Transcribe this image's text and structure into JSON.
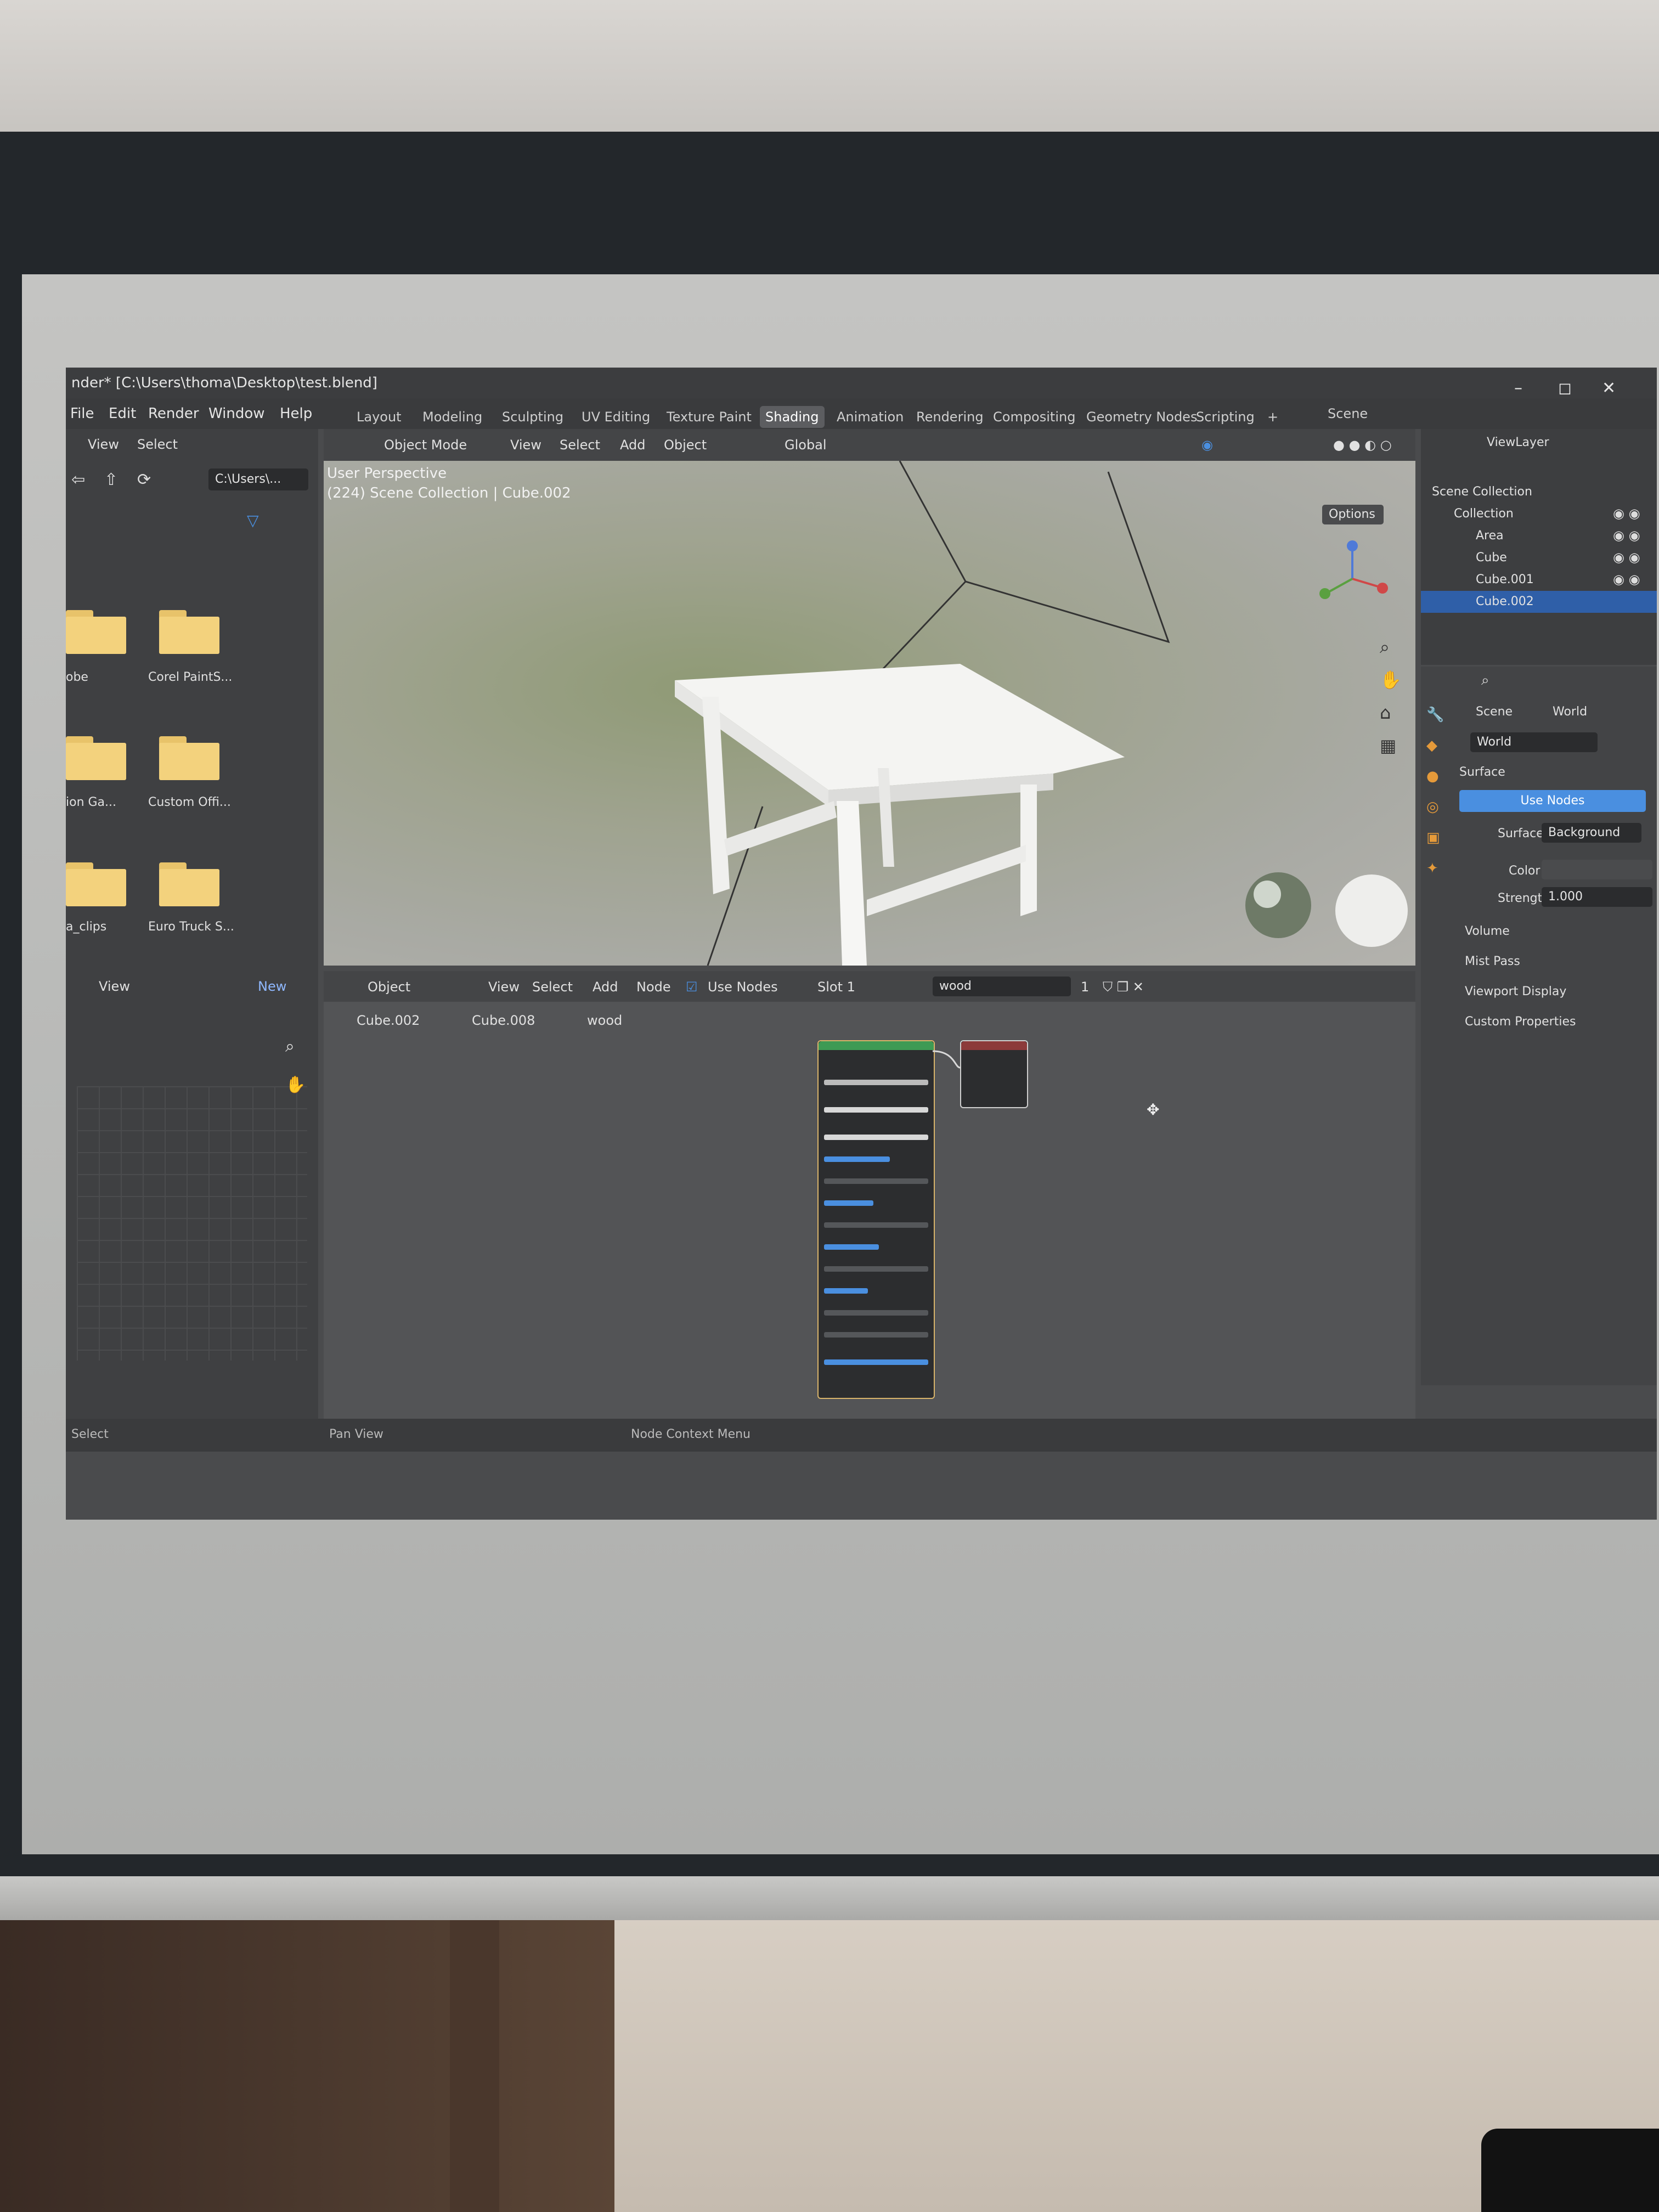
{
  "window": {
    "title": "nder* [C:\\Users\\thoma\\Desktop\\test.blend]",
    "menu": [
      "File",
      "Edit",
      "Render",
      "Window",
      "Help"
    ],
    "controls": [
      "–",
      "◻",
      "✕"
    ]
  },
  "workspace_tabs": [
    "Layout",
    "Modeling",
    "Sculpting",
    "UV Editing",
    "Texture Paint",
    "Shading",
    "Animation",
    "Rendering",
    "Compositing",
    "Geometry Nodes",
    "Scripting",
    "+"
  ],
  "active_workspace": "Shading",
  "file_browser": {
    "header": [
      "View",
      "Select"
    ],
    "path": "C:\\Users\\...",
    "folders": [
      "obe",
      "Corel PaintS...",
      "ion Ga...",
      "Custom Offi...",
      "a_clips",
      "Euro Truck S..."
    ]
  },
  "viewport": {
    "mode": "Object Mode",
    "menu": [
      "View",
      "Select",
      "Add",
      "Object"
    ],
    "orientation": "Global",
    "perspective_label": "User Perspective",
    "collection_label": "(224) Scene Collection | Cube.002",
    "options_label": "Options"
  },
  "scene_selector": "Scene",
  "view_layer": "ViewLayer",
  "outliner": {
    "rows": [
      "Scene Collection",
      "Collection",
      "Area",
      "Cube",
      "Cube.001",
      "Cube.002"
    ]
  },
  "properties": {
    "breadcrumb": [
      "Scene",
      "World"
    ],
    "world_name": "World",
    "surface_panel": "Surface",
    "use_nodes_button": "Use Nodes",
    "surface_label": "Surface",
    "surface_value": "Background",
    "color_label": "Color",
    "strength_label": "Strength",
    "strength_value": "1.000",
    "collapsed_panels": [
      "Volume",
      "Mist Pass",
      "Viewport Display",
      "Custom Properties"
    ]
  },
  "node_editor": {
    "left_header": [
      "View",
      "New"
    ],
    "type": "Object",
    "menu": [
      "View",
      "Select",
      "Add",
      "Node"
    ],
    "use_nodes_label": "Use Nodes",
    "slot": "Slot 1",
    "material": "wood",
    "user_count": "1",
    "breadcrumb": [
      "Cube.002",
      "Cube.008",
      "wood"
    ]
  },
  "status_bar": [
    "Select",
    "Pan View",
    "Node Context Menu"
  ],
  "colors": {
    "accent_blue": "#4a8fe0",
    "selection_blue": "#2f5fa8",
    "folder_yellow": "#f3d27d",
    "node_green_header": "#3e9a54"
  }
}
